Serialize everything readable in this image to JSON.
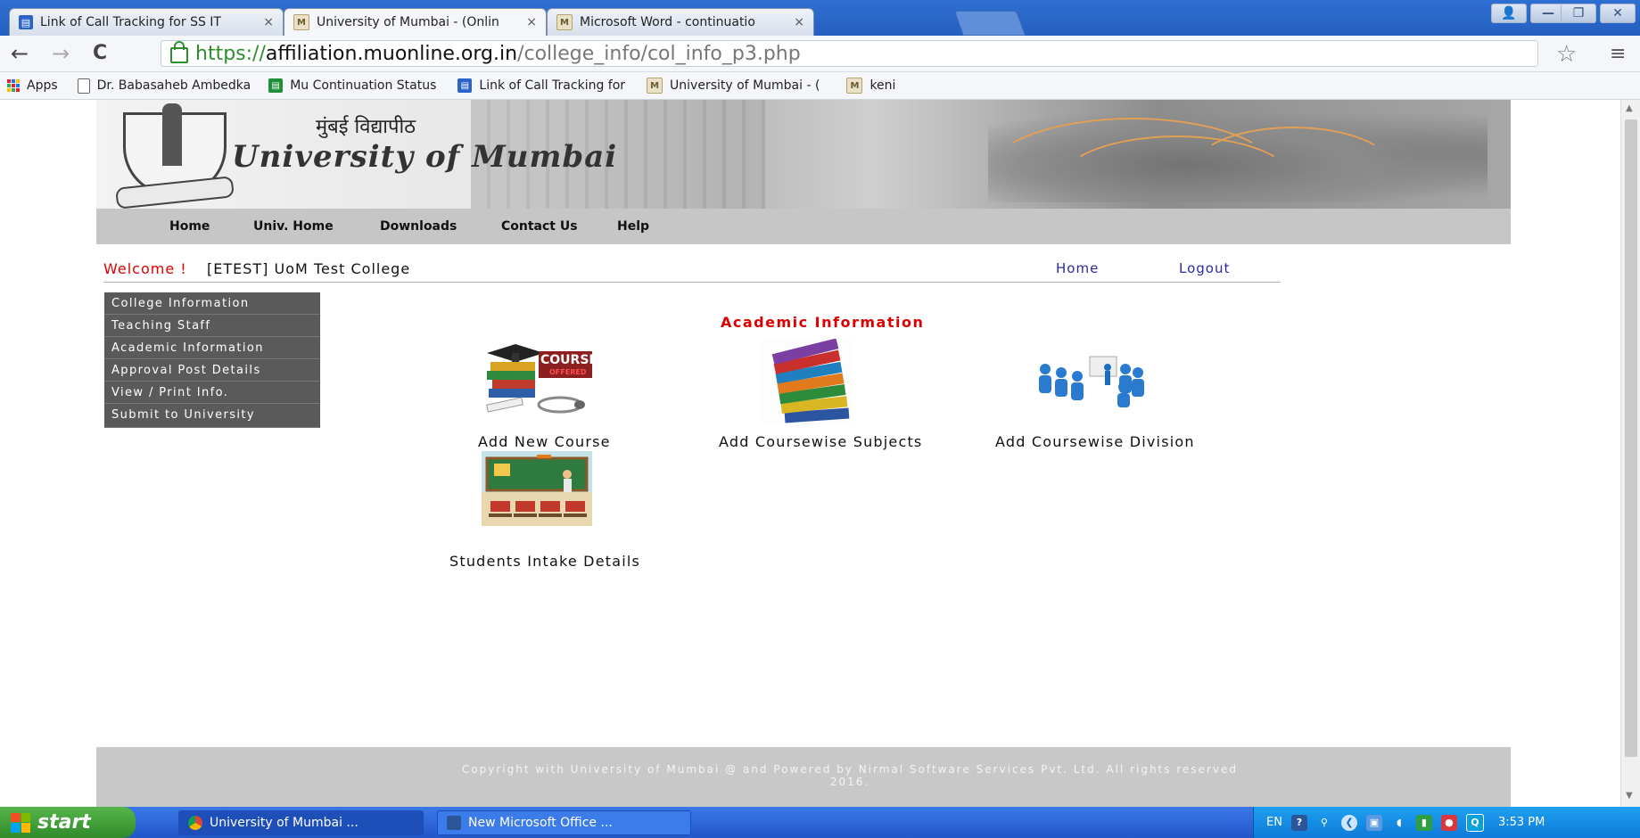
{
  "browser": {
    "tabs": [
      {
        "label": "Link of Call Tracking for SS IT",
        "icon": "sheet-icon",
        "active": false
      },
      {
        "label": "University of Mumbai - (Onlin",
        "icon": "uni-icon",
        "active": true
      },
      {
        "label": "Microsoft Word - continuatio",
        "icon": "word-icon",
        "active": false
      }
    ],
    "close_glyph": "×",
    "window_buttons": {
      "user": "👤",
      "minimize": "—",
      "maximize": "❐",
      "close": "✕"
    },
    "nav": {
      "back": "←",
      "forward": "→",
      "reload": "C"
    },
    "url": {
      "scheme": "https://",
      "host": "affiliation.muonline.org.in",
      "path": "/college_info/col_info_p3.php"
    },
    "star_glyph": "☆",
    "menu_glyph": "≡",
    "bookmarks": [
      {
        "label": "Apps",
        "icon": "apps-grid-icon"
      },
      {
        "label": "Dr. Babasaheb Ambedka",
        "icon": "page-icon"
      },
      {
        "label": "Mu Continuation Status",
        "icon": "sheet-green-icon"
      },
      {
        "label": "Link of Call Tracking for",
        "icon": "sheet-blue-icon"
      },
      {
        "label": "University of Mumbai - (",
        "icon": "uni-icon"
      },
      {
        "label": "keni",
        "icon": "uni-icon"
      }
    ]
  },
  "site": {
    "title_hindi": "मुंबई विद्यापीठ",
    "title_english": "University of Mumbai",
    "nav": [
      "Home",
      "Univ. Home",
      "Downloads",
      "Contact Us",
      "Help"
    ],
    "welcome": "Welcome !",
    "college": "[ETEST] UoM Test College",
    "links": {
      "home": "Home",
      "logout": "Logout"
    },
    "side_menu": [
      "College Information",
      "Teaching Staff",
      "Academic Information",
      "Approval Post Details",
      "View / Print Info.",
      "Submit to University"
    ],
    "section_title": "Academic Information",
    "tiles": [
      {
        "label": "Add New Course",
        "image_text": "COURSES",
        "image_subtext": "OFFERED"
      },
      {
        "label": "Add Coursewise Subjects"
      },
      {
        "label": "Add Coursewise Division"
      },
      {
        "label": "Students Intake Details"
      }
    ],
    "footer": {
      "line1": "Copyright with University of Mumbai @ and Powered by Nirmal Software Services Pvt. Ltd. All rights reserved",
      "line2": "2016."
    }
  },
  "taskbar": {
    "start": "start",
    "items": [
      {
        "label": "University of Mumbai ...",
        "icon": "chrome-icon"
      },
      {
        "label": "New Microsoft Office ...",
        "icon": "word-doc-icon"
      }
    ],
    "tray": {
      "lang": "EN",
      "time": "3:53 PM"
    }
  },
  "colors": {
    "accent_red": "#dd0000",
    "menu_bg": "#5a5a5a",
    "taskbar_blue": "#2356c8",
    "start_green": "#3a9a32"
  }
}
